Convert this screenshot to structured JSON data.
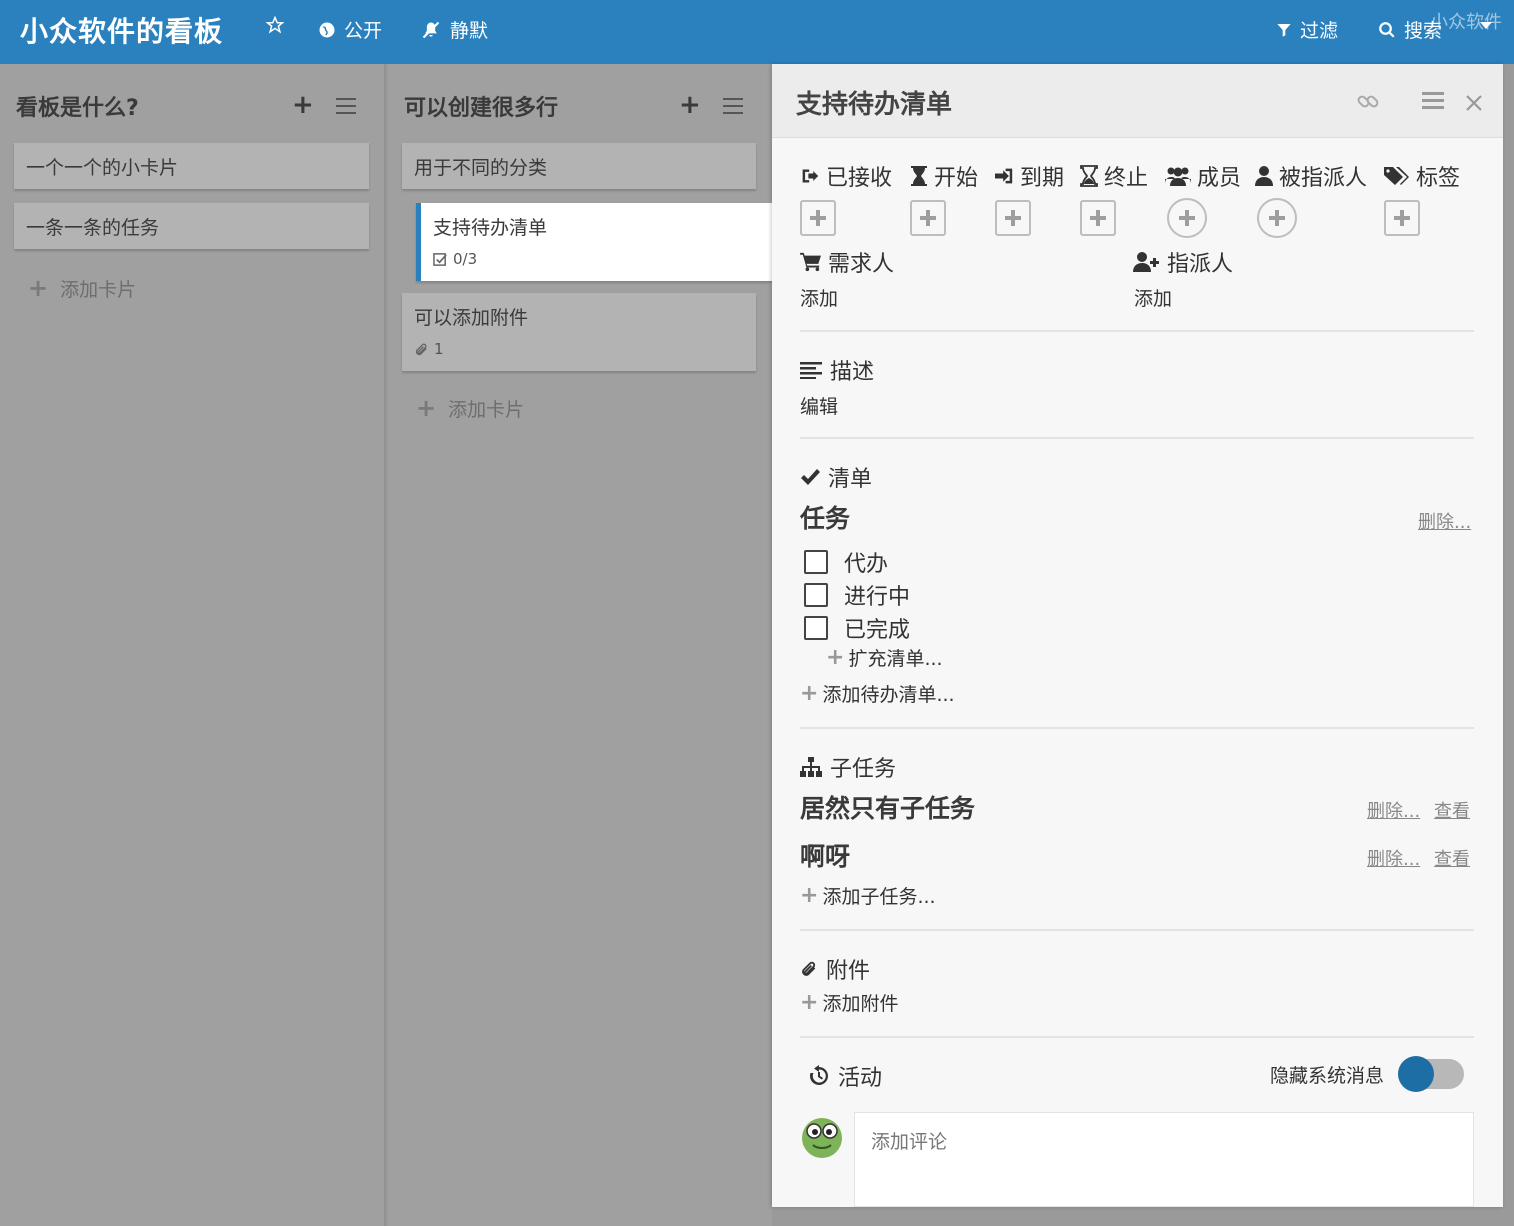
{
  "header": {
    "board_title": "小众软件的看板",
    "public_label": "公开",
    "mute_label": "静默",
    "filter_label": "过滤",
    "search_label": "搜索",
    "watermark": "小众软件",
    "bar_color": "#2b80be"
  },
  "lists": [
    {
      "title": "看板是什么?",
      "cards": [
        {
          "title": "一个一个的小卡片"
        },
        {
          "title": "一条一条的任务"
        }
      ],
      "add_card_label": "添加卡片"
    },
    {
      "title": "可以创建很多行",
      "cards": [
        {
          "title": "用于不同的分类"
        },
        {
          "title": "支持待办清单",
          "badge": "0/3",
          "active": true
        },
        {
          "title": "可以添加附件",
          "badge": "1"
        }
      ],
      "add_card_label": "添加卡片"
    }
  ],
  "detail": {
    "title": "支持待办清单",
    "attributes": {
      "received": "已接收",
      "start": "开始",
      "due": "到期",
      "end": "终止",
      "members": "成员",
      "assignee": "被指派人",
      "labels": "标签",
      "requester": "需求人",
      "requester_value": "添加",
      "assigner": "指派人",
      "assigner_value": "添加"
    },
    "description": {
      "title": "描述",
      "action": "编辑"
    },
    "checklist": {
      "section_title": "清单",
      "name": "任务",
      "delete_label": "删除...",
      "items": [
        "代办",
        "进行中",
        "已完成"
      ],
      "expand_label": "扩充清单...",
      "add_label": "添加待办清单..."
    },
    "subtasks": {
      "section_title": "子任务",
      "items": [
        {
          "title": "居然只有子任务",
          "delete_label": "删除...",
          "view_label": "查看"
        },
        {
          "title": "啊呀",
          "delete_label": "删除...",
          "view_label": "查看"
        }
      ],
      "add_label": "添加子任务..."
    },
    "attachments": {
      "section_title": "附件",
      "add_label": "添加附件"
    },
    "activity": {
      "section_title": "活动",
      "hide_system_label": "隐藏系统消息",
      "hide_system_on": true,
      "comment_placeholder": "添加评论"
    }
  }
}
